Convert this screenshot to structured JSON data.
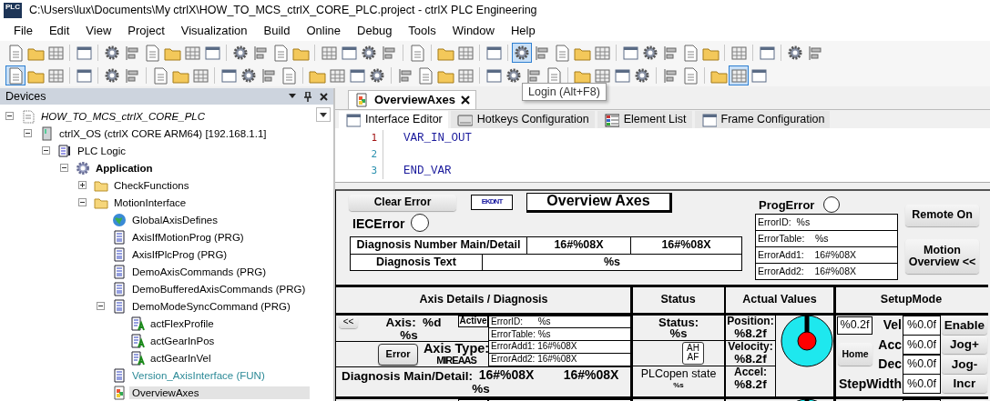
{
  "window": {
    "logo_text": "PLC",
    "title": "C:\\Users\\lux\\Documents\\My ctrlX\\HOW_TO_MCS_ctrlX_CORE_PLC.project - ctrlX PLC Engineering"
  },
  "menu": [
    "File",
    "Edit",
    "View",
    "Project",
    "Visualization",
    "Build",
    "Online",
    "Debug",
    "Tools",
    "Window",
    "Help"
  ],
  "toolbars": [
    {
      "groups": [
        [
          {
            "selected": false
          },
          {
            "selected": false
          },
          {
            "selected": false
          }
        ],
        [
          {
            "selected": false
          }
        ],
        [
          {
            "selected": false
          },
          {
            "selected": false
          },
          {
            "selected": false
          },
          {
            "selected": false
          },
          {
            "selected": false
          },
          {
            "selected": false
          }
        ],
        [
          {
            "selected": false
          },
          {
            "selected": false
          },
          {
            "selected": false
          },
          {
            "selected": false
          }
        ],
        [
          {
            "selected": false
          },
          {
            "selected": false
          },
          {
            "selected": false
          },
          {
            "selected": false
          }
        ],
        [
          {
            "selected": false
          }
        ],
        [
          {
            "selected": false
          },
          {
            "selected": false
          }
        ],
        [
          {
            "selected": false
          }
        ],
        [
          {
            "selected": true
          },
          {
            "selected": false
          },
          {
            "selected": false
          },
          {
            "selected": false
          },
          {
            "selected": false
          }
        ],
        [
          {
            "selected": false
          },
          {
            "selected": false
          },
          {
            "selected": false
          },
          {
            "selected": false
          },
          {
            "selected": false
          }
        ],
        [
          {
            "selected": false
          }
        ],
        [
          {
            "selected": false
          }
        ],
        [
          {
            "selected": false
          },
          {
            "selected": false
          }
        ]
      ]
    },
    {
      "groups": [
        [
          {
            "selected": true
          },
          {
            "selected": false
          },
          {
            "selected": false
          }
        ],
        [
          {
            "selected": false
          }
        ],
        [
          {
            "selected": false
          },
          {
            "selected": false
          }
        ],
        [
          {
            "selected": false
          },
          {
            "selected": false
          },
          {
            "selected": false
          }
        ],
        [
          {
            "selected": false
          },
          {
            "selected": false
          },
          {
            "selected": false
          },
          {
            "selected": false
          }
        ],
        [
          {
            "selected": false
          },
          {
            "selected": false
          },
          {
            "selected": false
          },
          {
            "selected": false
          }
        ],
        [
          {
            "selected": false
          },
          {
            "selected": false
          },
          {
            "selected": false
          },
          {
            "selected": false
          }
        ],
        [
          {
            "selected": false
          },
          {
            "selected": false
          },
          {
            "selected": false
          },
          {
            "selected": false
          }
        ],
        [
          {
            "selected": false
          },
          {
            "selected": false
          },
          {
            "selected": false
          },
          {
            "selected": false
          }
        ],
        [
          {
            "selected": false
          },
          {
            "selected": false
          }
        ],
        [
          {
            "selected": false
          },
          {
            "selected": true
          },
          {
            "selected": false
          }
        ]
      ]
    }
  ],
  "tooltip": "Login (Alt+F8)",
  "devices": {
    "title": "Devices",
    "tree": [
      {
        "label": "HOW_TO_MCS_ctrlX_CORE_PLC",
        "kind": "project",
        "expanded": true,
        "selected": false,
        "children": [
          {
            "label": "ctrlX_OS (ctrlX CORE ARM64) [192.168.1.1]",
            "kind": "device",
            "expanded": true,
            "selected": false,
            "children": [
              {
                "label": "PLC Logic",
                "kind": "plc",
                "expanded": true,
                "selected": false,
                "children": [
                  {
                    "label": "Application",
                    "kind": "application",
                    "expanded": true,
                    "selected": false,
                    "children": [
                      {
                        "label": "CheckFunctions",
                        "kind": "folder",
                        "expanded": false,
                        "selected": false
                      },
                      {
                        "label": "MotionInterface",
                        "kind": "folder",
                        "expanded": true,
                        "selected": false,
                        "children": [
                          {
                            "label": "GlobalAxisDefines",
                            "kind": "gvl",
                            "selected": false
                          },
                          {
                            "label": "AxisIfMotionProg (PRG)",
                            "kind": "program",
                            "selected": false
                          },
                          {
                            "label": "AxisIfPlcProg (PRG)",
                            "kind": "program",
                            "selected": false
                          },
                          {
                            "label": "DemoAxisCommands (PRG)",
                            "kind": "program",
                            "selected": false
                          },
                          {
                            "label": "DemoBufferedAxisCommands (PRG)",
                            "kind": "program",
                            "selected": false
                          },
                          {
                            "label": "DemoModeSyncCommand (PRG)",
                            "kind": "program",
                            "expanded": true,
                            "selected": false,
                            "children": [
                              {
                                "label": "actFlexProfile",
                                "kind": "action",
                                "selected": false
                              },
                              {
                                "label": "actGearInPos",
                                "kind": "action",
                                "selected": false
                              },
                              {
                                "label": "actGearInVel",
                                "kind": "action",
                                "selected": false
                              }
                            ]
                          },
                          {
                            "label": "Version_AxisInterface (FUN)",
                            "kind": "function",
                            "selected": false
                          },
                          {
                            "label": "OverviewAxes",
                            "kind": "visualization",
                            "selected": true
                          }
                        ]
                      }
                    ]
                  }
                ]
              }
            ]
          }
        ]
      }
    ]
  },
  "editor": {
    "document_tab": {
      "label": "OverviewAxes",
      "selected": true
    },
    "tabs": [
      {
        "label": "Interface Editor",
        "selected": true
      },
      {
        "label": "Hotkeys Configuration",
        "selected": false
      },
      {
        "label": "Element List",
        "selected": false
      },
      {
        "label": "Frame Configuration",
        "selected": false
      }
    ],
    "code": [
      {
        "number": "1",
        "text": "VAR_IN_OUT",
        "current": true
      },
      {
        "number": "2",
        "current": false
      },
      {
        "number": "3",
        "text": "END_VAR",
        "current": false
      }
    ]
  },
  "visualization": {
    "clear_error_button": "Clear Error",
    "error_count_label": "EKDNT",
    "title": "Overview Axes",
    "prog_error": {
      "label": "ProgError",
      "active": false,
      "rows": [
        "ErrorID:  %s",
        "ErrorTable:    %s",
        "ErrorAdd1:    16#%08X",
        "ErrorAdd2:    16#%08X"
      ]
    },
    "remote_on_button": "Remote On",
    "motion_overview_button": "Motion Overview <<",
    "iec_error": {
      "label": "IECError",
      "active": false
    },
    "diagnosis": {
      "number_label": "Diagnosis Number Main/Detail",
      "number_main": "16#%08X",
      "number_detail": "16#%08X",
      "text_label": "Diagnosis Text",
      "text": "%s"
    },
    "columns": [
      "Axis Details / Diagnosis",
      "Status",
      "Actual Values",
      "SetupMode"
    ],
    "axes": [
      {
        "back_button": "<<",
        "axis": "Axis:  %d",
        "name": "%s",
        "active_label": "Active",
        "error_rows": [
          "ErrorID:      %s",
          "ErrorTable: %s",
          "ErrorAdd1: 16#%08X",
          "ErrorAdd2: 16#%08X"
        ],
        "error_button": "Error",
        "axis_type_label": "Axis Type:",
        "axis_type": "MIREAAS",
        "diagnosis_label": "Diagnosis Main/Detail:",
        "diagnosis_main": "16#%08X",
        "diagnosis_detail": "16#%08X",
        "diagnosis_text": "%s",
        "status_label": "Status:",
        "status": "%s",
        "ah_af_button": "AH AF",
        "plcopen_label": "PLCopen state",
        "plcopen_state": "%s",
        "position_label": "Position:",
        "position": "%8.2f",
        "velocity_label": "Velocity:",
        "velocity": "%8.2f",
        "accel_label": "Accel:",
        "accel": "%8.2f",
        "step_value": "%0.2f",
        "home_button": "Home",
        "params": [
          {
            "label": "Vel",
            "value": "%0.0f",
            "button": "Enable"
          },
          {
            "label": "Acc",
            "value": "%0.0f",
            "button": "Jog+"
          },
          {
            "label": "Dec",
            "value": "%0.0f",
            "button": "Jog-"
          },
          {
            "label": "StepWidth",
            "value": "%0.0f",
            "button": "Incr"
          }
        ]
      }
    ]
  }
}
